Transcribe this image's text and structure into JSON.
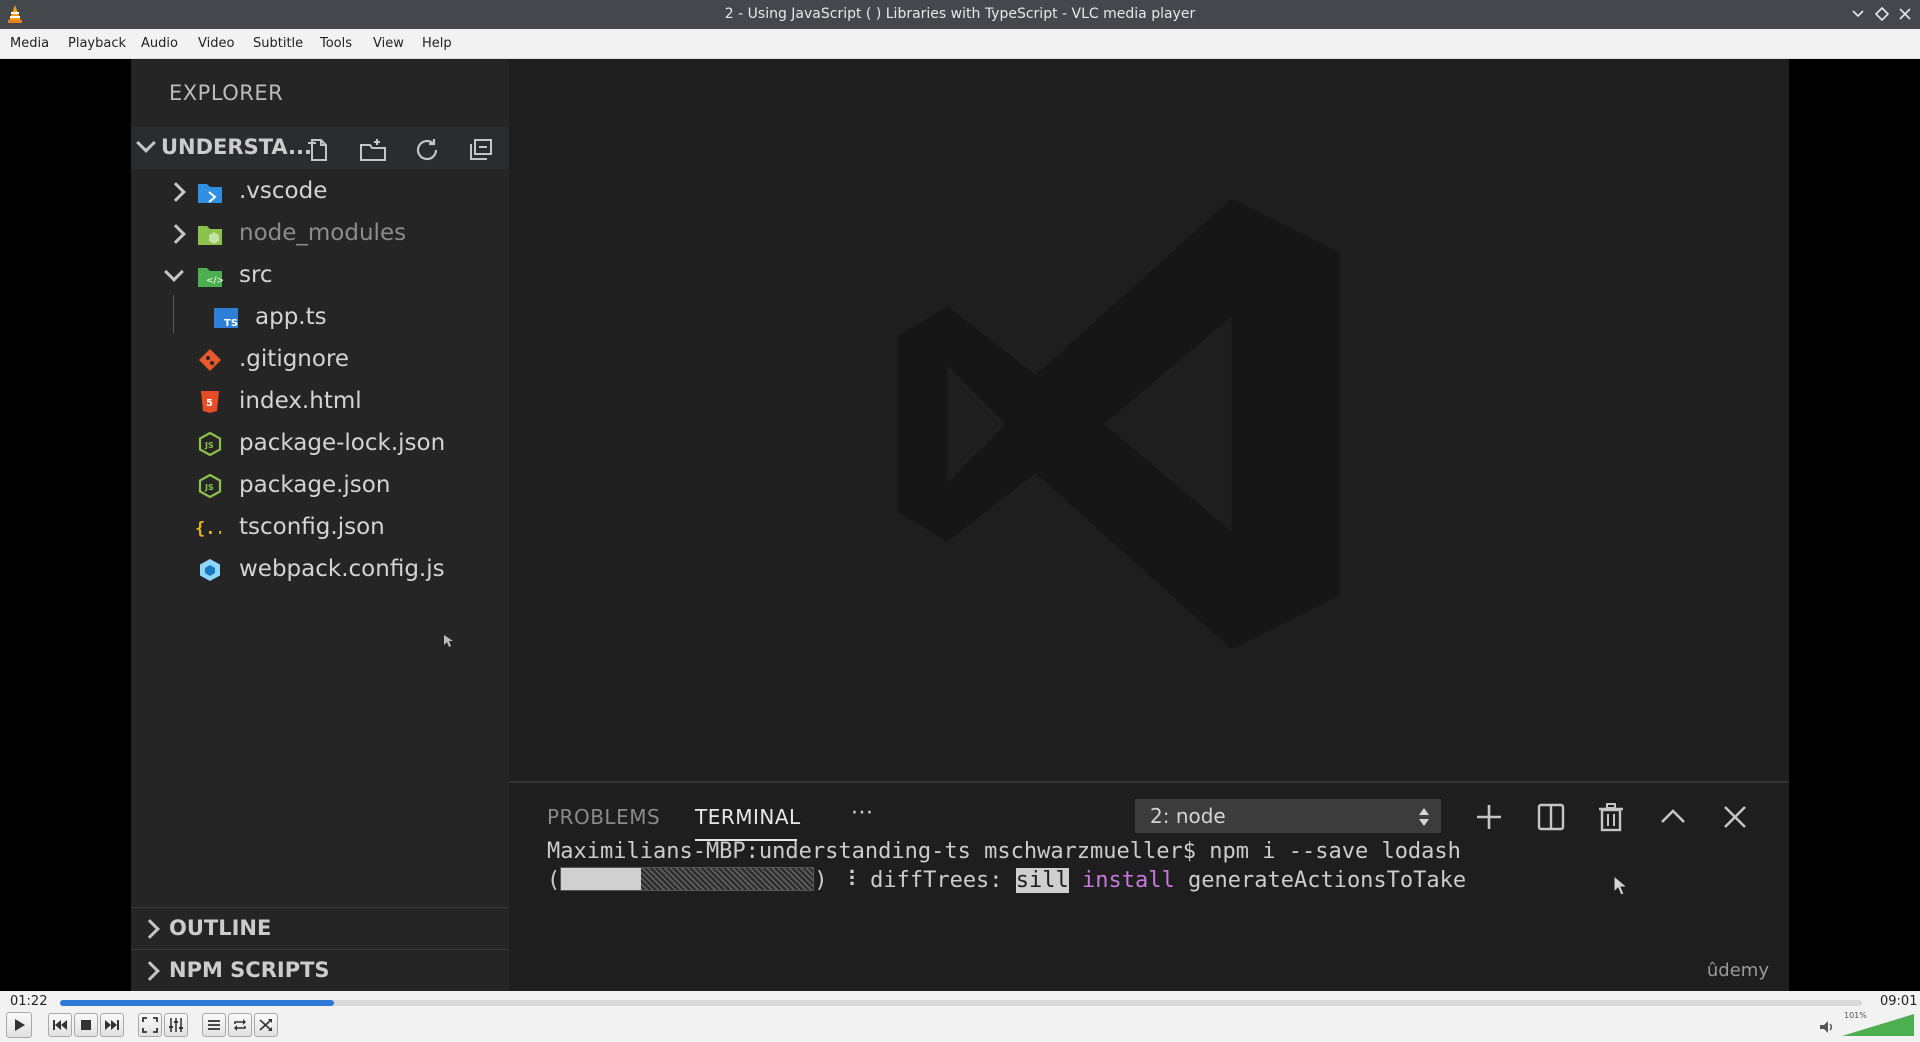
{
  "window": {
    "title": "2 - Using JavaScript ( ) Libraries with TypeScript - VLC media player"
  },
  "menubar": {
    "items": [
      "Media",
      "Playback",
      "Audio",
      "Video",
      "Subtitle",
      "Tools",
      "View",
      "Help"
    ]
  },
  "explorer": {
    "header": "EXPLORER",
    "project": "UNDERSTA...",
    "tree": [
      {
        "label": ".vscode",
        "type": "folder",
        "expanded": false
      },
      {
        "label": "node_modules",
        "type": "folder",
        "expanded": false
      },
      {
        "label": "src",
        "type": "folder",
        "expanded": true
      },
      {
        "label": "app.ts",
        "type": "file-ts"
      },
      {
        "label": ".gitignore",
        "type": "file-git"
      },
      {
        "label": "index.html",
        "type": "file-html"
      },
      {
        "label": "package-lock.json",
        "type": "file-json"
      },
      {
        "label": "package.json",
        "type": "file-json"
      },
      {
        "label": "tsconfig.json",
        "type": "file-tsconfig"
      },
      {
        "label": "webpack.config.js",
        "type": "file-webpack"
      }
    ],
    "outline": "OUTLINE",
    "npm_scripts": "NPM SCRIPTS"
  },
  "panel": {
    "tabs": [
      "PROBLEMS",
      "TERMINAL"
    ],
    "active_tab": "TERMINAL",
    "more": "···",
    "terminal_select": "2: node",
    "terminal": {
      "prompt": "Maximilians-MBP:understanding-ts mschwarzmueller$ npm i --save lodash",
      "progress_prefix": "(",
      "progress_suffix": ") ⠸ diffTrees: ",
      "sill": "sill",
      "install": "install",
      "rest": "generateActionsToTake"
    }
  },
  "watermark": "ûdemy",
  "player": {
    "elapsed": "01:22",
    "duration": "09:01",
    "progress": 0.152,
    "volume_label": "101%",
    "volume": 1.01
  },
  "colors": {
    "accent": "#2f78d8",
    "terminal_magenta": "#c678dd",
    "volume_green": "#4caf50"
  }
}
